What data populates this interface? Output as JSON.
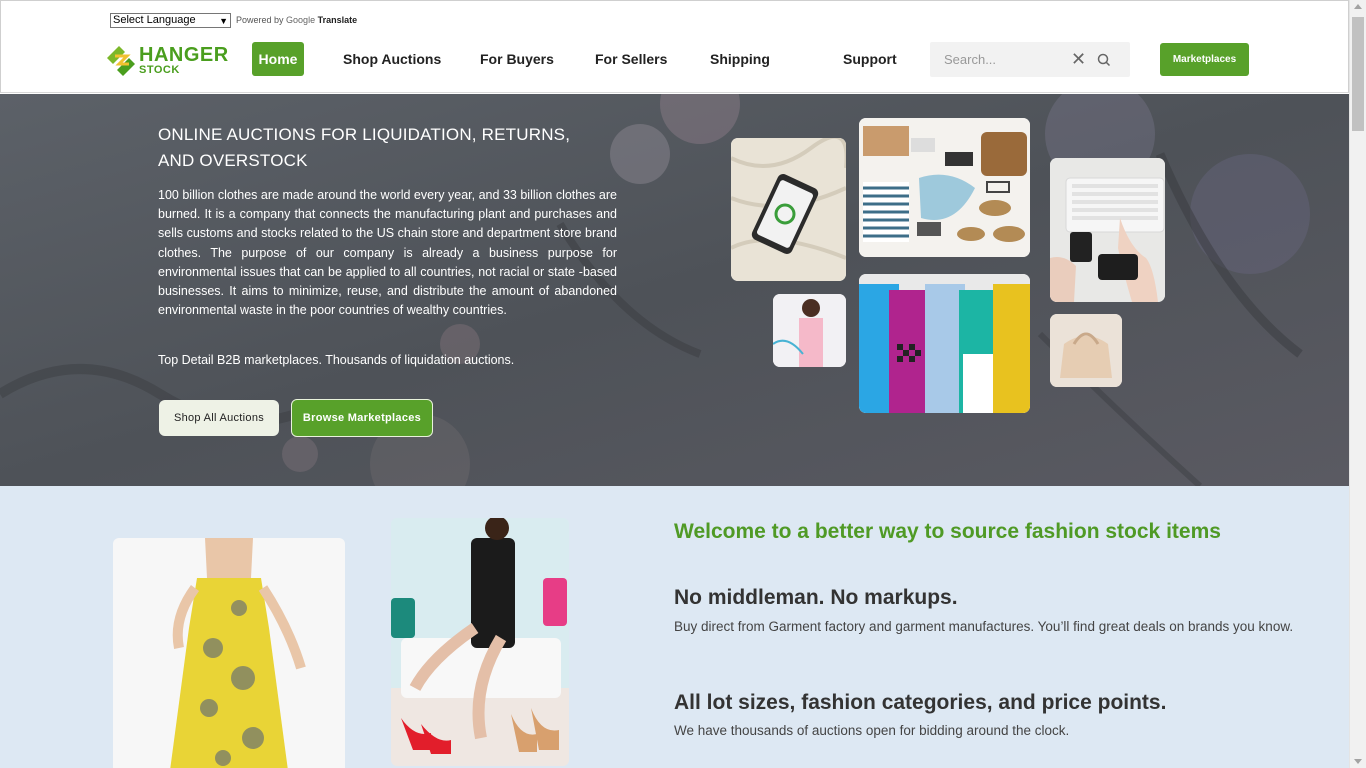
{
  "header": {
    "language_select": "Select Language",
    "powered_by": "Powered by",
    "google": "Google",
    "translate": "Translate",
    "logo_line1": "HANGER",
    "logo_line2": "STOCK",
    "nav": {
      "home": "Home",
      "shop_auctions": "Shop Auctions",
      "for_buyers": "For Buyers",
      "for_sellers": "For Sellers",
      "shipping": "Shipping",
      "support": "Support"
    },
    "search_placeholder": "Search...",
    "marketplaces_button": "Marketplaces"
  },
  "hero": {
    "title_line1": "ONLINE AUCTIONS FOR LIQUIDATION, RETURNS,",
    "title_line2": "AND OVERSTOCK",
    "paragraph": "100 billion clothes are made around the world every year, and 33 billion clothes are burned. It is a company that connects the manufacturing plant and purchases and sells customs and stocks related to the US chain store and department store brand clothes. The purpose of our company is already a business purpose for environmental issues that can be applied to all countries, not racial or state -based businesses. It aims to minimize, reuse, and distribute the amount of abandoned environmental waste in the poor countries of wealthy countries.",
    "tagline": "Top Detail B2B marketplaces. Thousands of liquidation auctions.",
    "shop_button": "Shop All Auctions",
    "browse_button": "Browse Marketplaces"
  },
  "lower": {
    "welcome": "Welcome to a better way to source fashion stock items",
    "heading1": "No middleman. No markups.",
    "text1": "Buy direct from Garment factory and garment manufactures. You’ll find great deals on brands you know.",
    "heading2": "All lot sizes, fashion categories, and price points.",
    "text2": "We have thousands of auctions open for bidding around the clock."
  },
  "colors": {
    "brand_green": "#58a12a",
    "welcome_green": "#4f9a25",
    "lower_bg": "#dde8f3"
  }
}
